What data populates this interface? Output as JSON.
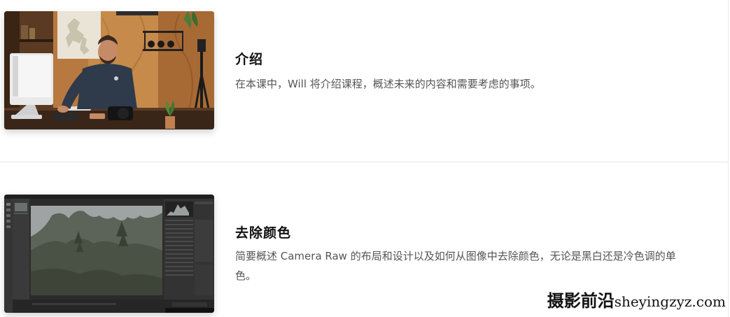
{
  "lessons": [
    {
      "title": "介绍",
      "description": "在本课中，Will 将介绍课程，概述未来的内容和需要考虑的事项。",
      "thumbnail_icon": "video-thumbnail-instructor"
    },
    {
      "title": "去除颜色",
      "description": "简要概述 Camera Raw 的布局和设计以及如何从图像中去除颜色，无论是黑白还是冷色调的单色。",
      "thumbnail_icon": "video-thumbnail-camera-raw"
    }
  ],
  "watermark": {
    "brand": "摄影前沿",
    "domain": "sheyingzyz.com"
  },
  "colors": {
    "divider": "#e6e6e6",
    "title": "#111111",
    "description": "#555555"
  }
}
